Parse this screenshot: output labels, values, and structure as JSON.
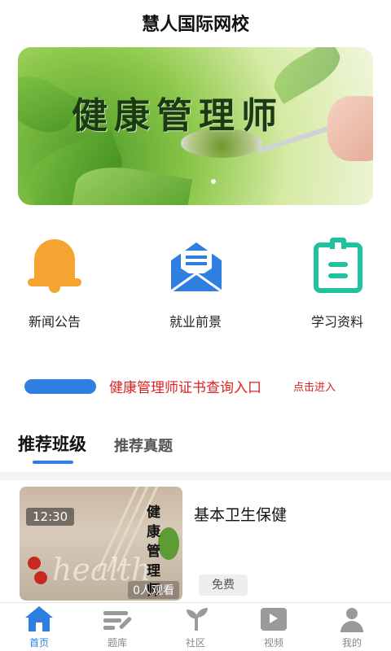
{
  "app": {
    "title": "慧人国际网校"
  },
  "banner": {
    "text": "健康管理师"
  },
  "quick_links": [
    {
      "label": "新闻公告",
      "icon": "bell-icon"
    },
    {
      "label": "就业前景",
      "icon": "envelope-icon"
    },
    {
      "label": "学习资料",
      "icon": "notebook-icon"
    }
  ],
  "certificate": {
    "link": "健康管理师证书查询入口",
    "action": "点击进入"
  },
  "tabs": {
    "active": "推荐班级",
    "inactive": "推荐真题"
  },
  "course": {
    "duration": "12:30",
    "thumb_title": "健康管理师",
    "views": "0人观看",
    "name": "基本卫生保健",
    "price_tag": "免费"
  },
  "bottom_nav": [
    {
      "label": "首页",
      "icon": "home-icon",
      "active": true
    },
    {
      "label": "题库",
      "icon": "question-bank-icon",
      "active": false
    },
    {
      "label": "社区",
      "icon": "sprout-icon",
      "active": false
    },
    {
      "label": "视频",
      "icon": "video-icon",
      "active": false
    },
    {
      "label": "我的",
      "icon": "user-icon",
      "active": false
    }
  ],
  "colors": {
    "accent": "#2f7fe0",
    "alert_red": "#e02020",
    "bell_orange": "#f5a431",
    "notebook_green": "#1fc19e"
  }
}
